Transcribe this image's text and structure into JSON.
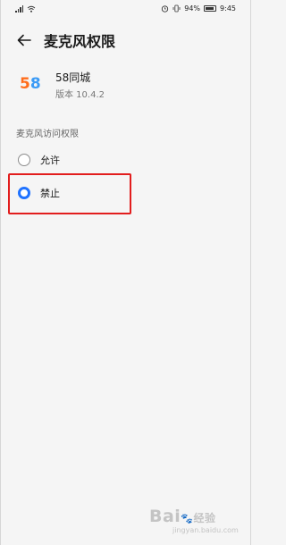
{
  "status_bar": {
    "battery": "94%",
    "time": "9:45"
  },
  "header": {
    "title": "麦克风权限"
  },
  "app": {
    "name": "58同城",
    "version": "版本 10.4.2"
  },
  "section": {
    "title": "麦克风访问权限"
  },
  "options": [
    {
      "label": "允许",
      "selected": false
    },
    {
      "label": "禁止",
      "selected": true
    }
  ],
  "watermark": {
    "main": "Bai",
    "suffix": "经验",
    "sub": "jingyan.baidu.com"
  },
  "colors": {
    "accent": "#1f72ff",
    "highlight_box": "#e21d1d",
    "background": "#f5f5f5"
  }
}
